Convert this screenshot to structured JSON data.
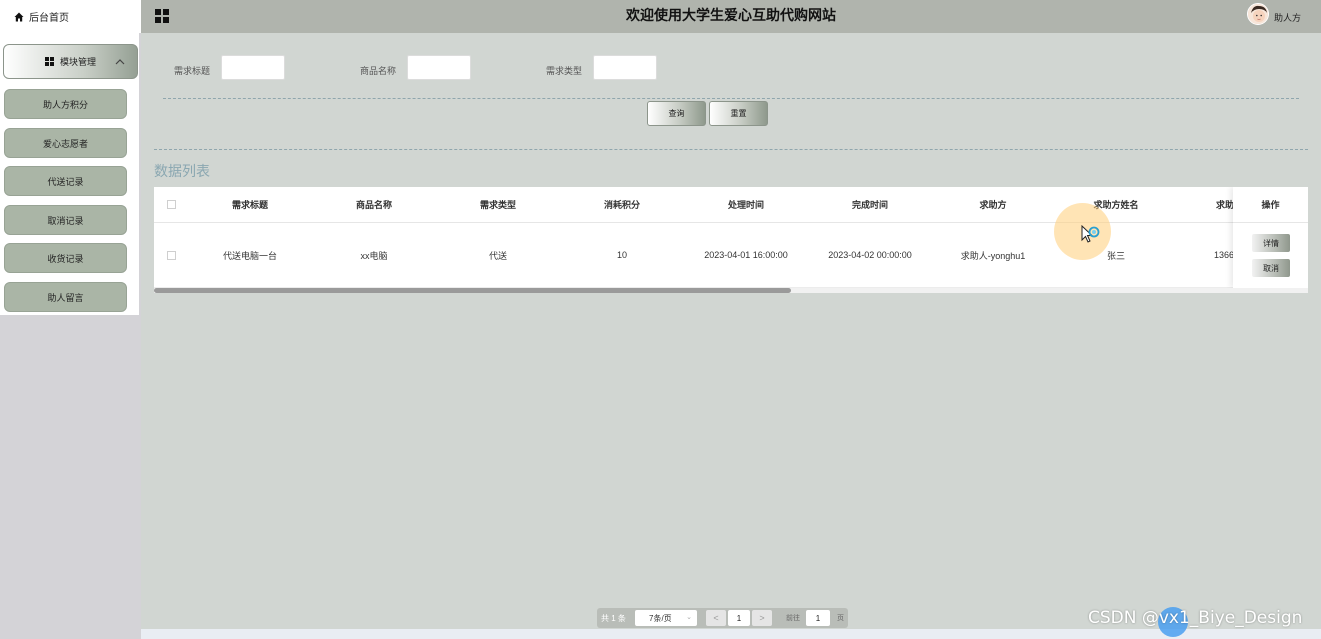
{
  "sidebar": {
    "home_label": "后台首页",
    "module_label": "模块管理",
    "items": [
      {
        "label": "助人方积分"
      },
      {
        "label": "爱心志愿者"
      },
      {
        "label": "代送记录"
      },
      {
        "label": "取消记录"
      },
      {
        "label": "收货记录"
      },
      {
        "label": "助人留言"
      }
    ]
  },
  "header": {
    "title": "欢迎使用大学生爱心互助代购网站",
    "username": "助人方"
  },
  "search": {
    "fields": [
      {
        "label": "需求标题",
        "value": ""
      },
      {
        "label": "商品名称",
        "value": ""
      },
      {
        "label": "需求类型",
        "value": ""
      }
    ],
    "query_label": "查询",
    "reset_label": "重置"
  },
  "list": {
    "title": "数据列表",
    "columns": [
      "需求标题",
      "商品名称",
      "需求类型",
      "消耗积分",
      "处理时间",
      "完成时间",
      "求助方",
      "求助方姓名",
      "求助"
    ],
    "rows": [
      {
        "cells": [
          "代送电脑一台",
          "xx电脑",
          "代送",
          "10",
          "2023-04-01 16:00:00",
          "2023-04-02 00:00:00",
          "求助人-yonghu1",
          "张三",
          "1366"
        ],
        "actions": [
          "详情",
          "取消"
        ]
      }
    ],
    "op_header": "操作"
  },
  "pagination": {
    "total": "共 1 条",
    "page_size": "7条/页",
    "prev": "<",
    "current": "1",
    "next": ">",
    "goto_label": "前往",
    "goto_value": "1",
    "page_suffix": "页"
  },
  "watermark": "CSDN @vx1_Biye_Design",
  "colors": {
    "topbar": "#b0b4ad",
    "main_bg": "#d1d6d2",
    "menu_item": "#aab5a6",
    "list_title": "#8aa7b1"
  }
}
